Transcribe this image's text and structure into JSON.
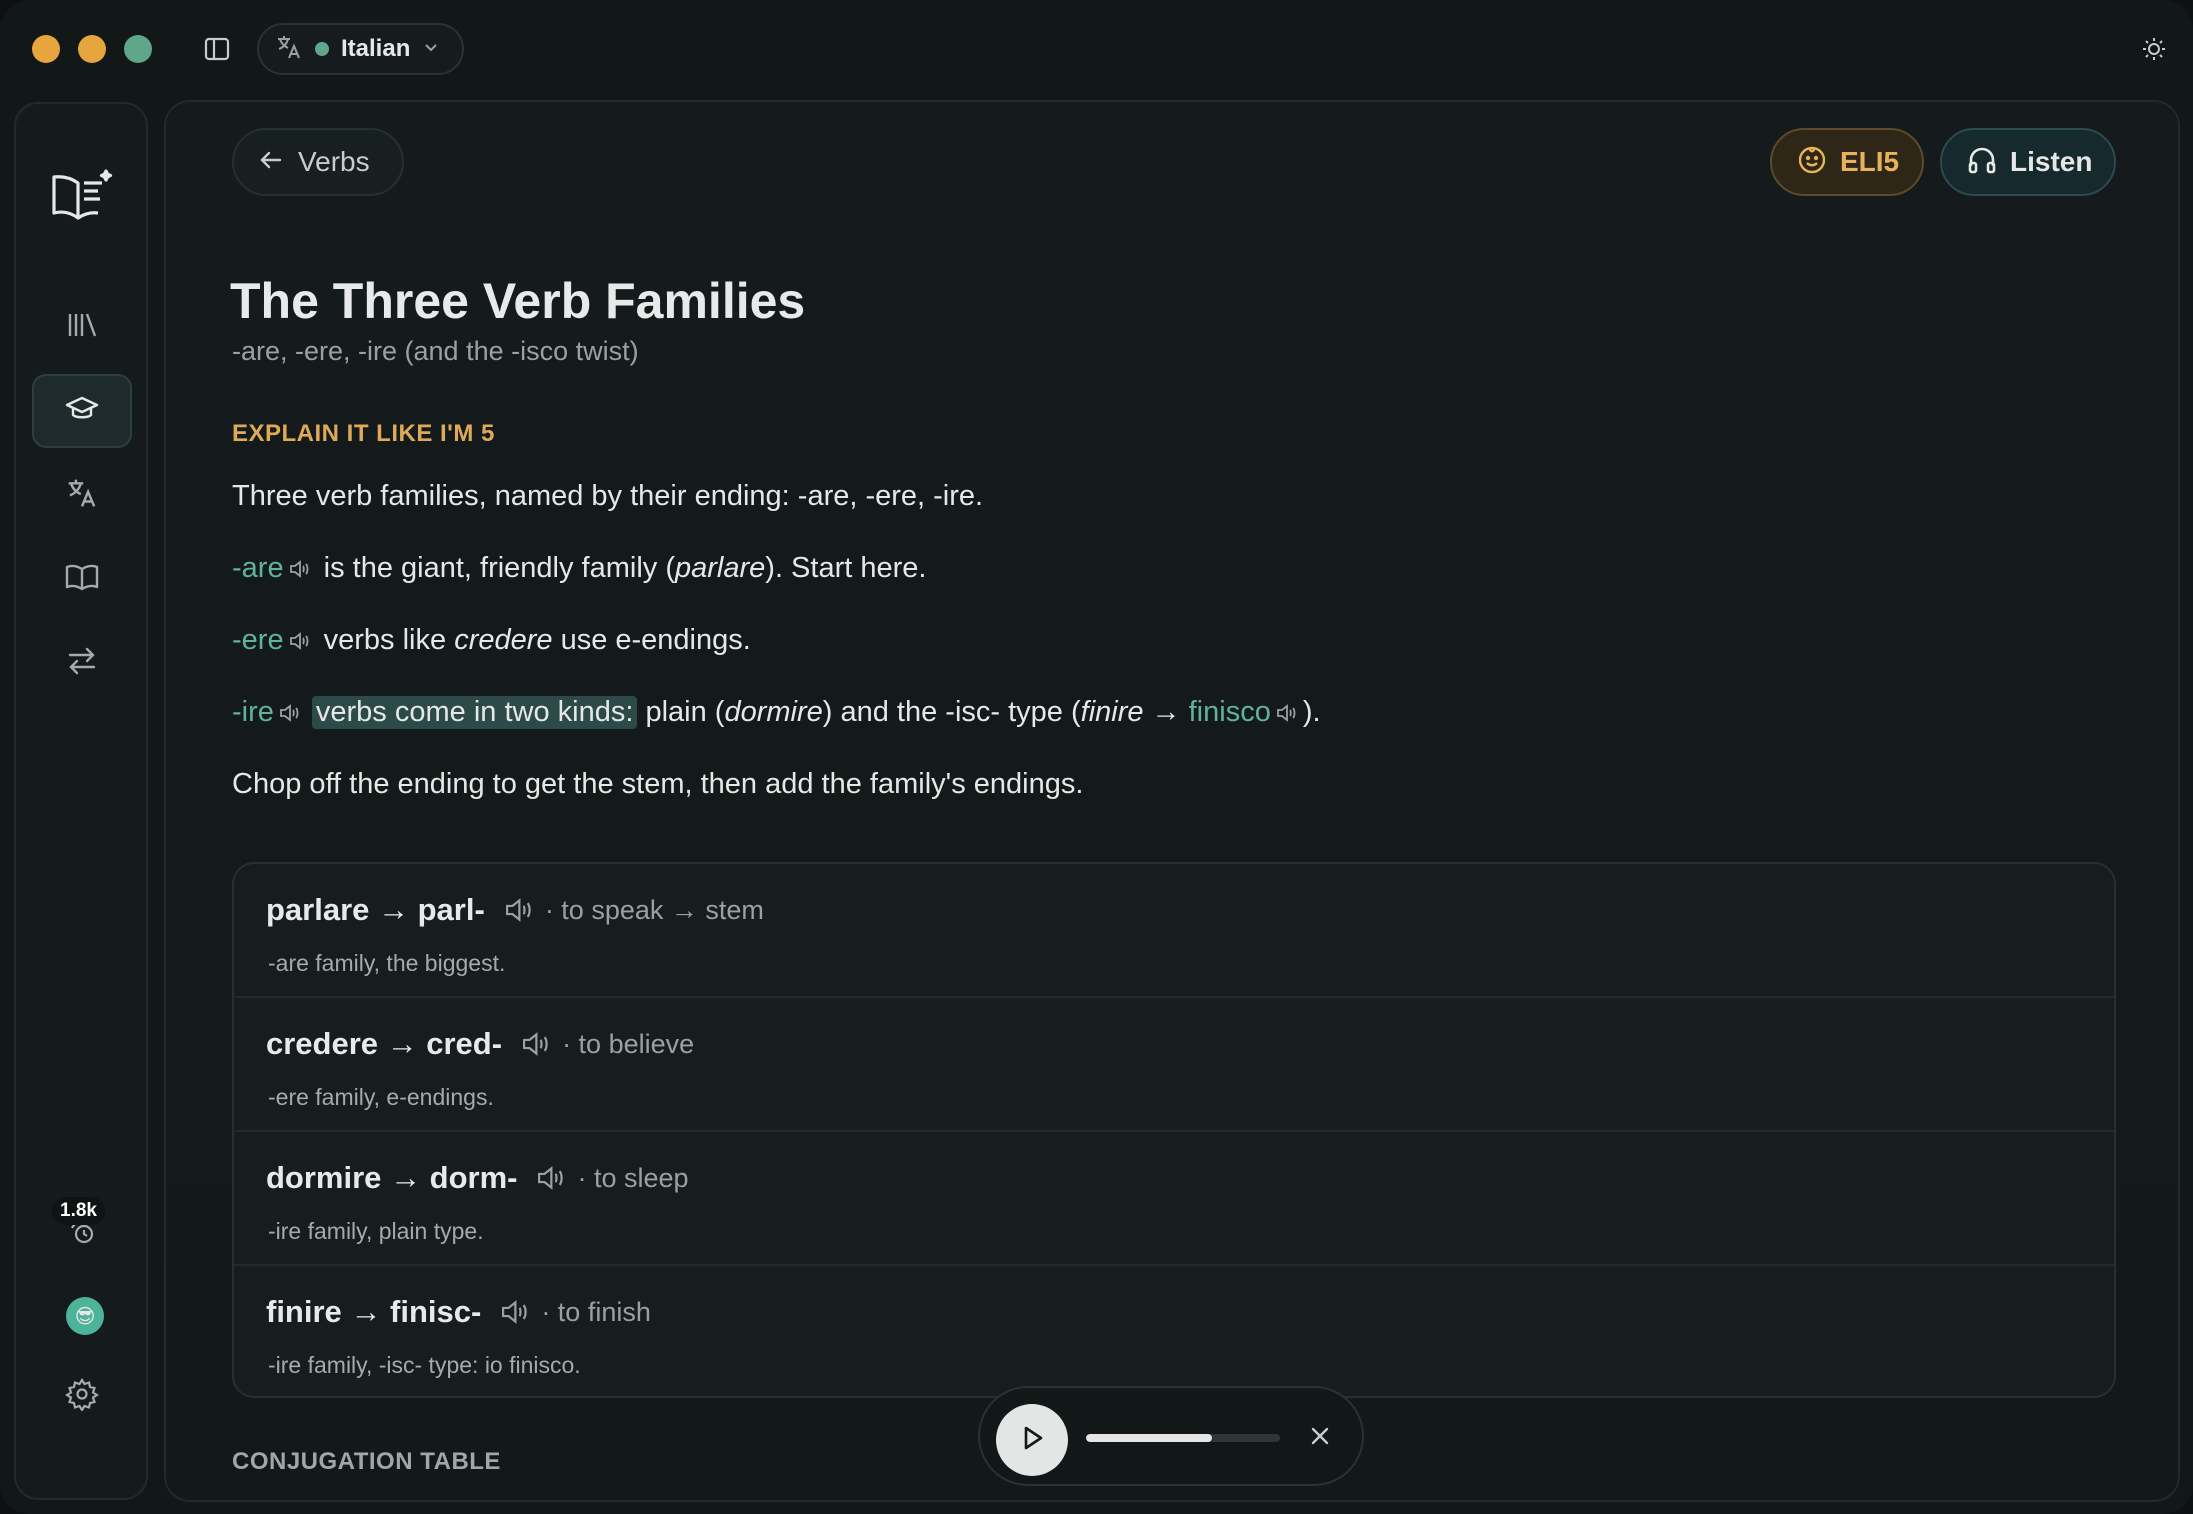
{
  "language": {
    "label": "Italian"
  },
  "header": {
    "back_label": "Verbs",
    "eli5_label": "ELI5",
    "listen_label": "Listen"
  },
  "lesson": {
    "title": "The Three Verb Families",
    "subtitle": "-are, -ere, -ire (and the -isco twist)",
    "eli5_heading": "EXPLAIN IT LIKE I'M 5",
    "p1": "Three verb families, named by their ending: -are, -ere, -ire.",
    "p2": {
      "term": "-are",
      "text_a": " is the giant, friendly family (",
      "em": "parlare",
      "text_b": "). Start here."
    },
    "p3": {
      "term": "-ere",
      "text_a": " verbs like ",
      "em": "credere",
      "text_b": " use e-endings."
    },
    "p4": {
      "term": "-ire",
      "mark": "verbs come in two kinds:",
      "text_a": " plain (",
      "em1": "dormire",
      "text_b": ") and the -isc- type (",
      "em2": "finire",
      "arrow": " → ",
      "term2": "finisco",
      "text_c": ")."
    },
    "p5": "Chop off the ending to get the stem, then add the family's endings.",
    "conjugation_heading": "CONJUGATION TABLE"
  },
  "verbs": [
    {
      "main": "parlare → parl-",
      "gloss": "· to speak → stem",
      "note": "-are family, the biggest."
    },
    {
      "main": "credere → cred-",
      "gloss": "· to believe",
      "note": "-ere family, e-endings."
    },
    {
      "main": "dormire → dorm-",
      "gloss": "· to sleep",
      "note": "-ire family, plain type."
    },
    {
      "main": "finire → finisc-",
      "gloss": "· to finish",
      "note": "-ire family, -isc- type: io finisco."
    }
  ],
  "rail": {
    "badge": "1.8k",
    "avatar": "😎"
  },
  "player": {
    "progress": 0.65
  },
  "colors": {
    "accent": "#5fb39a",
    "eli5": "#e8b25a"
  },
  "icons": [
    "translate-icon",
    "sidebar-toggle-icon",
    "chevron-down-icon",
    "sun-icon",
    "arrow-left-icon",
    "baby-face-icon",
    "headphones-icon",
    "speaker-icon",
    "play-icon",
    "close-icon",
    "library-icon",
    "graduation-cap-icon",
    "book-open-icon",
    "swap-icon",
    "streak-icon",
    "settings-icon"
  ]
}
